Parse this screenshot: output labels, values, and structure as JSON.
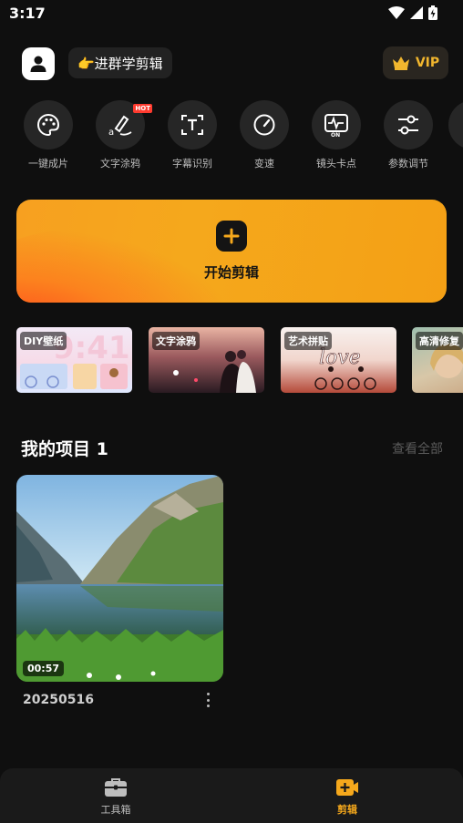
{
  "status_bar": {
    "time": "3:17"
  },
  "header": {
    "group_label": "👉进群学剪辑",
    "vip_label": "VIP"
  },
  "tools": [
    {
      "label": "一键成片",
      "icon": "palette-icon"
    },
    {
      "label": "文字涂鸦",
      "icon": "text-brush-icon",
      "badge": "HOT"
    },
    {
      "label": "字幕识别",
      "icon": "subtitle-scan-icon"
    },
    {
      "label": "变速",
      "icon": "speed-gauge-icon"
    },
    {
      "label": "镜头卡点",
      "icon": "beat-sync-icon",
      "icon_text": "ON"
    },
    {
      "label": "参数调节",
      "icon": "sliders-icon"
    }
  ],
  "start_card": {
    "label": "开始剪辑"
  },
  "templates": [
    {
      "tag": "DIY壁纸",
      "art_text": "9:41"
    },
    {
      "tag": "文字涂鸦"
    },
    {
      "tag": "艺术拼贴",
      "art_text": "love"
    },
    {
      "tag": "高清修复"
    }
  ],
  "projects": {
    "title": "我的项目 1",
    "see_all": "查看全部",
    "items": [
      {
        "name": "20250516",
        "duration": "00:57"
      }
    ]
  },
  "bottom_nav": [
    {
      "label": "工具箱",
      "active": false
    },
    {
      "label": "剪辑",
      "active": true
    }
  ],
  "colors": {
    "accent": "#f5a81c",
    "vip_gold": "#f1b62e",
    "background": "#0f0f0f"
  }
}
